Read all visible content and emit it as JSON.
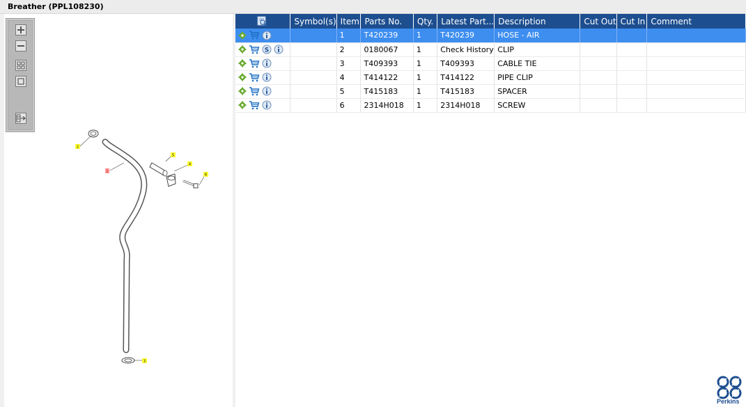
{
  "window": {
    "title": "Breather (PPL108230)"
  },
  "toolbar": {
    "buttons": [
      {
        "name": "zoom-in-button",
        "icon": "zoom-in-icon"
      },
      {
        "name": "zoom-out-button",
        "icon": "zoom-out-icon"
      },
      {
        "name": "fit-all-button",
        "icon": "fit-all-icon"
      },
      {
        "name": "fit-window-button",
        "icon": "fit-window-icon"
      },
      {
        "name": "export-button",
        "icon": "export-icon"
      }
    ]
  },
  "diagram": {
    "callouts": [
      "2",
      "1",
      "5",
      "4",
      "6",
      "3"
    ]
  },
  "table": {
    "columns": [
      "",
      "Symbol(s)",
      "Item",
      "Parts No.",
      "Qty.",
      "Latest Part...",
      "Description",
      "Cut Out",
      "Cut In",
      "Comment"
    ],
    "header_icon": "search-parts-icon",
    "rows": [
      {
        "item": "1",
        "parts_no": "T420239",
        "qty": "1",
        "latest": "T420239",
        "description": "HOSE - AIR",
        "cut_out": "",
        "cut_in": "",
        "comment": "",
        "has_s": false,
        "selected": true
      },
      {
        "item": "2",
        "parts_no": "0180067",
        "qty": "1",
        "latest": "Check History",
        "description": "CLIP",
        "cut_out": "",
        "cut_in": "",
        "comment": "",
        "has_s": true,
        "selected": false
      },
      {
        "item": "3",
        "parts_no": "T409393",
        "qty": "1",
        "latest": "T409393",
        "description": "CABLE TIE",
        "cut_out": "",
        "cut_in": "",
        "comment": "",
        "has_s": false,
        "selected": false
      },
      {
        "item": "4",
        "parts_no": "T414122",
        "qty": "1",
        "latest": "T414122",
        "description": "PIPE CLIP",
        "cut_out": "",
        "cut_in": "",
        "comment": "",
        "has_s": false,
        "selected": false
      },
      {
        "item": "5",
        "parts_no": "T415183",
        "qty": "1",
        "latest": "T415183",
        "description": "SPACER",
        "cut_out": "",
        "cut_in": "",
        "comment": "",
        "has_s": false,
        "selected": false
      },
      {
        "item": "6",
        "parts_no": "2314H018",
        "qty": "1",
        "latest": "2314H018",
        "description": "SCREW",
        "cut_out": "",
        "cut_in": "",
        "comment": "",
        "has_s": false,
        "selected": false
      }
    ]
  },
  "brand": {
    "name": "Perkins",
    "color": "#1d4e8f"
  },
  "colors": {
    "header": "#1d4e8f",
    "selected": "#3e8ef0",
    "gear": "#5aa02c",
    "cart": "#1d6fc4"
  }
}
